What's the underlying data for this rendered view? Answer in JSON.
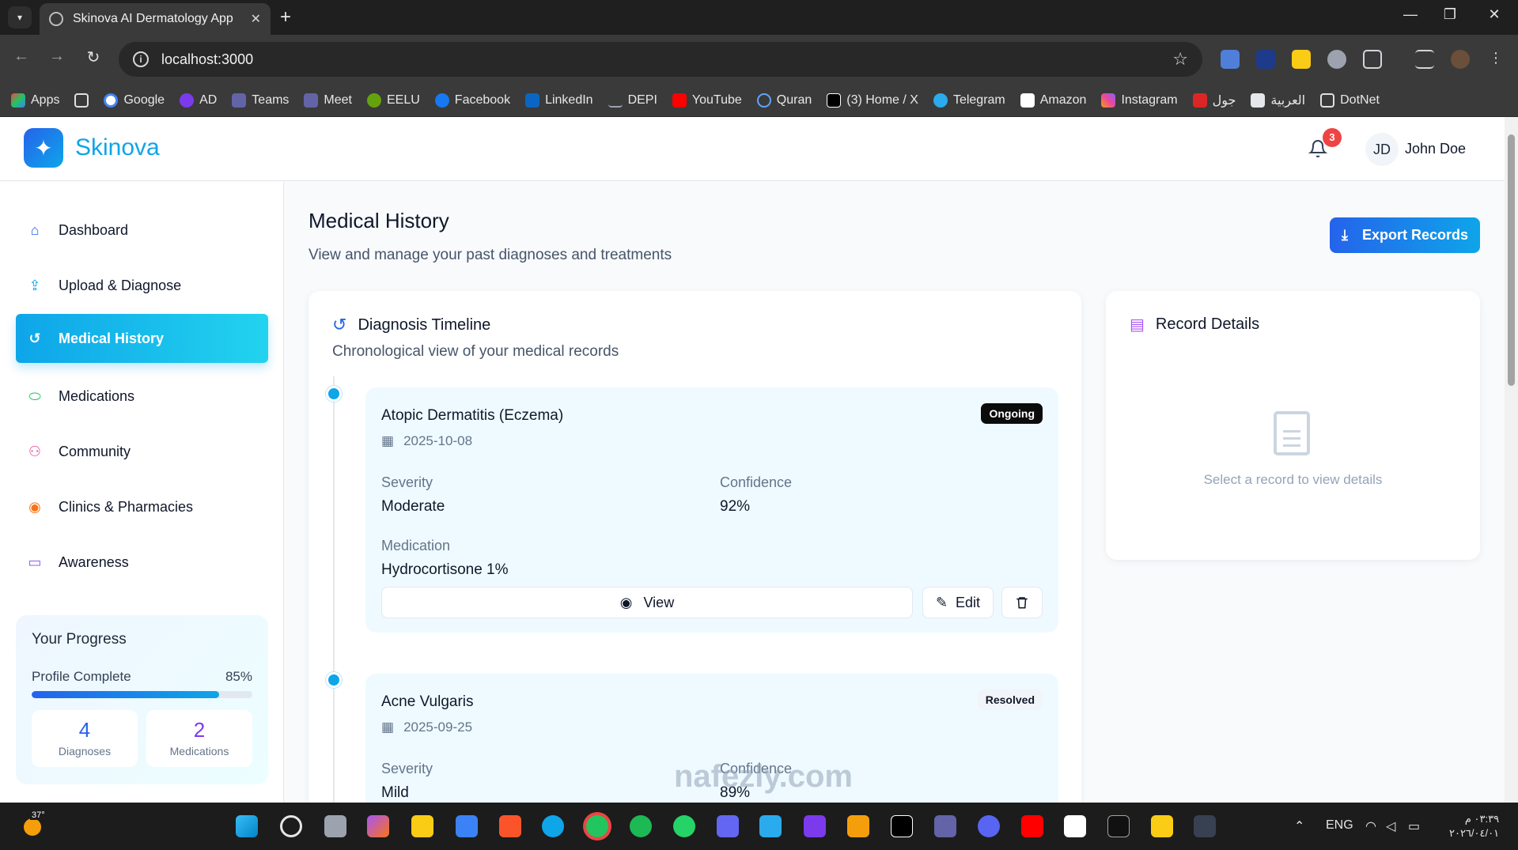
{
  "browser": {
    "tab_title": "Skinova AI Dermatology App",
    "url": "localhost:3000",
    "bookmarks": [
      "Apps",
      "Google",
      "AD",
      "Teams",
      "Meet",
      "EELU",
      "Facebook",
      "LinkedIn",
      "DEPI",
      "YouTube",
      "Quran",
      "(3) Home / X",
      "Telegram",
      "Amazon",
      "Instagram",
      "جول",
      "العربية",
      "DotNet"
    ]
  },
  "header": {
    "brand": "Skinova",
    "notification_count": "3",
    "user_initials": "JD",
    "user_name": "John Doe"
  },
  "sidebar": {
    "items": [
      {
        "label": "Dashboard",
        "icon": "home-icon"
      },
      {
        "label": "Upload & Diagnose",
        "icon": "upload-icon"
      },
      {
        "label": "Medical History",
        "icon": "history-icon"
      },
      {
        "label": "Medications",
        "icon": "pill-icon"
      },
      {
        "label": "Community",
        "icon": "users-icon"
      },
      {
        "label": "Clinics & Pharmacies",
        "icon": "map-pin-icon"
      },
      {
        "label": "Awareness",
        "icon": "video-icon"
      }
    ],
    "active_index": 2,
    "progress": {
      "title": "Your Progress",
      "label": "Profile Complete",
      "percent_text": "85%",
      "percent": 85,
      "stats": [
        {
          "value": "4",
          "label": "Diagnoses"
        },
        {
          "value": "2",
          "label": "Medications"
        }
      ]
    }
  },
  "main": {
    "title": "Medical History",
    "subtitle": "View and manage your past diagnoses and treatments",
    "export_label": "Export Records",
    "timeline": {
      "title": "Diagnosis Timeline",
      "subtitle": "Chronological view of your medical records",
      "records": [
        {
          "name": "Atopic Dermatitis (Eczema)",
          "date": "2025-10-08",
          "status": "Ongoing",
          "severity_label": "Severity",
          "severity": "Moderate",
          "confidence_label": "Confidence",
          "confidence": "92%",
          "medication_label": "Medication",
          "medication": "Hydrocortisone 1%",
          "view_label": "View",
          "edit_label": "Edit"
        },
        {
          "name": "Acne Vulgaris",
          "date": "2025-09-25",
          "status": "Resolved",
          "severity_label": "Severity",
          "severity": "Mild",
          "confidence_label": "Confidence",
          "confidence": "89%"
        }
      ]
    },
    "details": {
      "title": "Record Details",
      "empty_text": "Select a record to view details"
    }
  },
  "taskbar": {
    "temperature": "37°",
    "language": "ENG",
    "time": "٠٣:٣٩ م",
    "date": "٢٠٢٦/٠٤/٠١"
  },
  "watermark": "nafezly.com",
  "colors": {
    "accent": "#0ea5e9",
    "primary": "#2563eb",
    "danger": "#ef4444"
  }
}
